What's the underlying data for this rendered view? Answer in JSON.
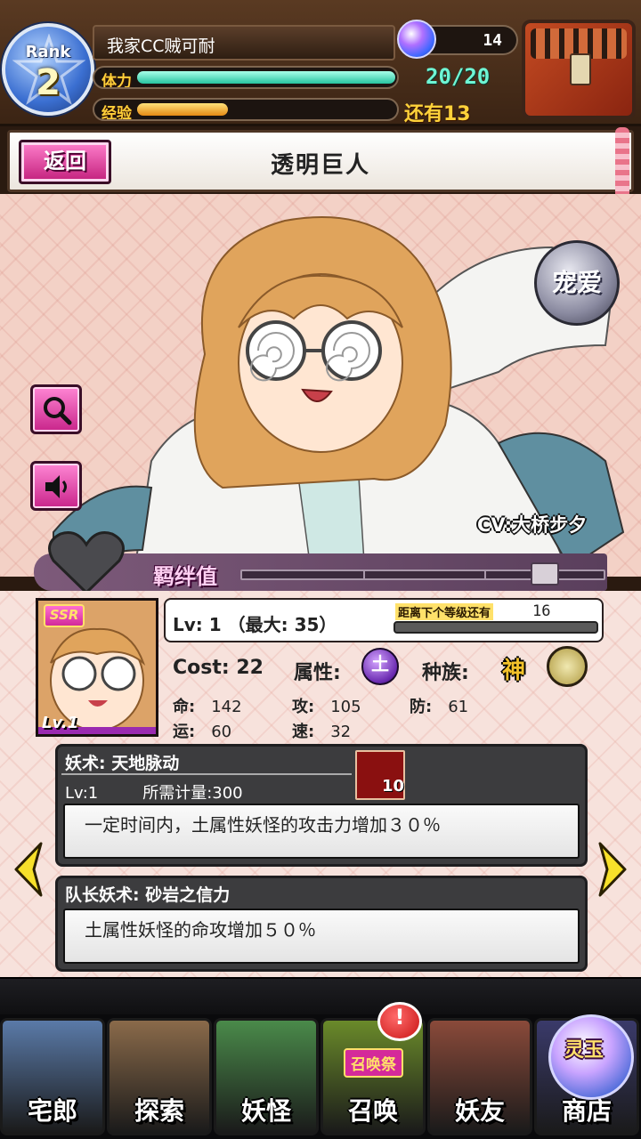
{
  "player": {
    "rank_label": "Rank",
    "rank_value": "2",
    "name": "我家CC贼可耐",
    "gems": "14",
    "stamina_label": "体力",
    "stamina_value": "20/20",
    "stamina_fill": 1.0,
    "exp_label": "经验",
    "exp_text": "还有13",
    "exp_fill": 0.35
  },
  "header": {
    "back_label": "返回",
    "title": "透明巨人"
  },
  "character": {
    "love_label": "宠爱",
    "cv": "CV:大桥步夕",
    "bond_label": "羁绊值",
    "rarity": "SSR",
    "card_level": "Lv.1",
    "lv_text": "Lv:  1  （最大: 35）",
    "next_level_label": "距离下个等级还有",
    "next_level_value": "16",
    "cost": "Cost: 22",
    "attribute_label": "属性:",
    "attribute_value": "土",
    "race_label": "种族:",
    "race_value": "神",
    "stats": {
      "hp_label": "命:",
      "hp": "142",
      "atk_label": "攻:",
      "atk": "105",
      "def_label": "防:",
      "def": "61",
      "luck_label": "运:",
      "luck": "60",
      "spd_label": "速:",
      "spd": "32"
    }
  },
  "skill": {
    "title": "妖术: 天地脉动",
    "level": "Lv:1",
    "gauge_cost": "所需计量:300",
    "gauge_count": "10",
    "description": "一定时间内，土属性妖怪的攻击力增加３０％"
  },
  "leader_skill": {
    "title": "队长妖术: 砂岩之信力",
    "description": "土属性妖怪的命攻增加５０％"
  },
  "nav": {
    "items": [
      {
        "label": "宅郎",
        "color": "#5a7aa8"
      },
      {
        "label": "探索",
        "color": "#8a6a4a"
      },
      {
        "label": "妖怪",
        "color": "#4a8a4a"
      },
      {
        "label": "召唤",
        "color": "#6a8a2a"
      },
      {
        "label": "妖友",
        "color": "#8a4a3a"
      },
      {
        "label": "商店",
        "color": "#3a3a6a"
      }
    ],
    "badge": "!",
    "summon_festival": "召唤祭",
    "shop_brand": "灵玉"
  }
}
